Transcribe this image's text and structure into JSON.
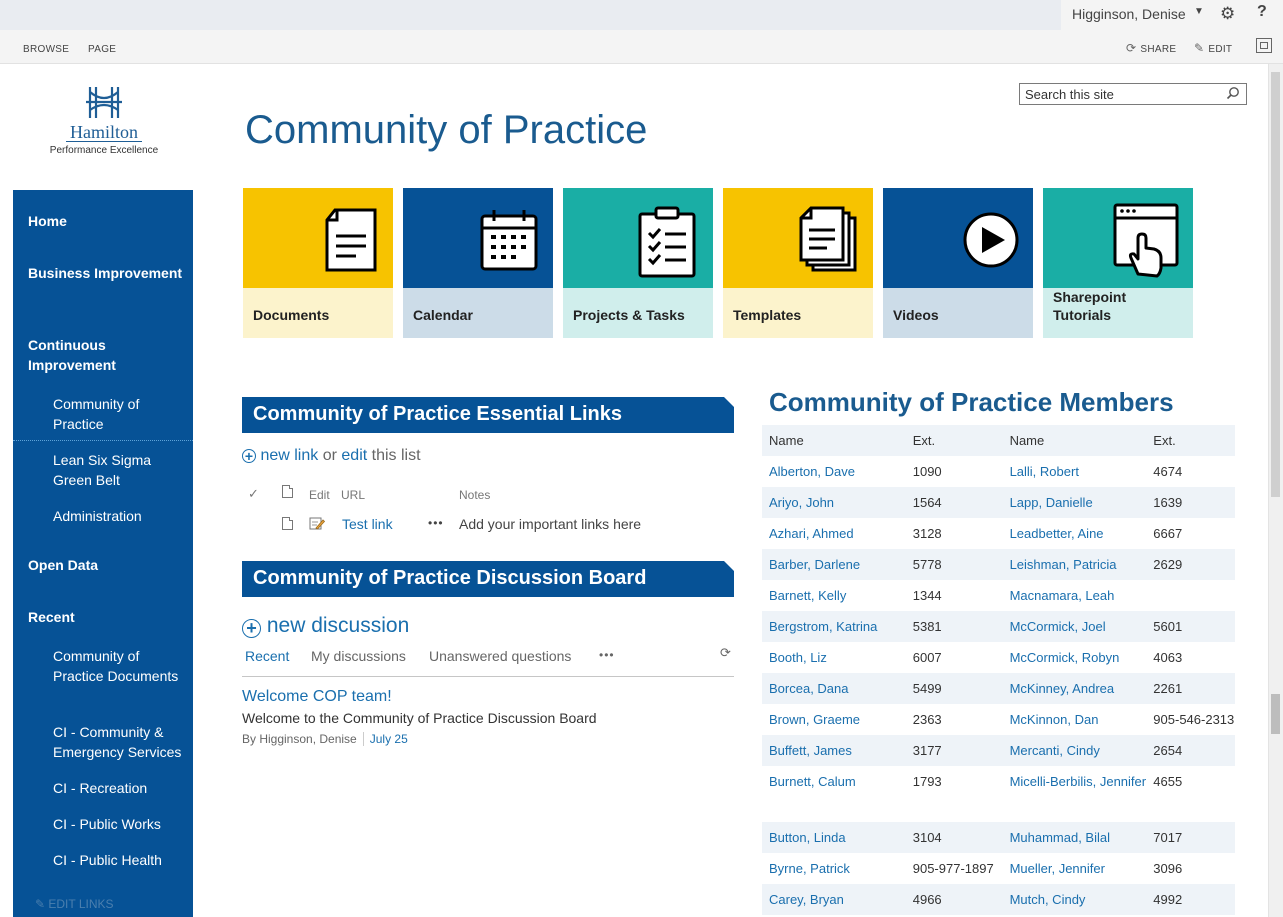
{
  "suite_bar": {
    "username": "Higginson, Denise"
  },
  "ribbon": {
    "tabs": [
      "BROWSE",
      "PAGE"
    ],
    "share_label": "SHARE",
    "edit_label": "EDIT"
  },
  "logo": {
    "name": "Hamilton",
    "tagline": "Performance Excellence"
  },
  "search": {
    "placeholder": "Search this site"
  },
  "page": {
    "title": "Community of Practice"
  },
  "nav": {
    "home": "Home",
    "business_improvement": "Business Improvement",
    "continuous_improvement": "Continuous Improvement",
    "community_of_practice": "Community of Practice",
    "lean_six_sigma": "Lean Six Sigma Green Belt",
    "administration": "Administration",
    "open_data": "Open Data",
    "recent": "Recent",
    "recent_items": [
      "Community of Practice Documents",
      "CI - Community & Emergency Services",
      "CI - Recreation",
      "CI - Public Works",
      "CI - Public Health"
    ],
    "edit_links": "EDIT LINKS"
  },
  "tiles": [
    {
      "label": "Documents",
      "top_color": "#f7c300",
      "bottom_color": "#fcf3cc",
      "icon": "document-icon"
    },
    {
      "label": "Calendar",
      "top_color": "#065296",
      "bottom_color": "#ccdce8",
      "icon": "calendar-icon"
    },
    {
      "label": "Projects & Tasks",
      "top_color": "#1aaea5",
      "bottom_color": "#d0eeec",
      "icon": "clipboard-checklist-icon"
    },
    {
      "label": "Templates",
      "top_color": "#f7c300",
      "bottom_color": "#fcf3cc",
      "icon": "stacked-documents-icon"
    },
    {
      "label": "Videos",
      "top_color": "#065296",
      "bottom_color": "#ccdce8",
      "icon": "play-icon"
    },
    {
      "label": "Sharepoint Tutorials",
      "top_color": "#1aaea5",
      "bottom_color": "#d0eeec",
      "icon": "browser-pointer-icon"
    }
  ],
  "essential_links": {
    "heading": "Community of Practice Essential Links",
    "new_link": "new link",
    "or": "or",
    "edit": "edit",
    "this_list": "this list",
    "columns": {
      "edit": "Edit",
      "url": "URL",
      "notes": "Notes"
    },
    "rows": [
      {
        "url": "Test link",
        "notes": "Add your important links here"
      }
    ]
  },
  "discussion": {
    "heading": "Community of Practice Discussion Board",
    "new_discussion": "new discussion",
    "tabs": [
      "Recent",
      "My discussions",
      "Unanswered questions",
      "•••"
    ],
    "post": {
      "title": "Welcome COP team!",
      "body": "Welcome to the Community of Practice Discussion Board",
      "author": "By Higginson, Denise",
      "date": "July 25"
    }
  },
  "members": {
    "title": "Community of Practice Members",
    "columns": [
      "Name",
      "Ext.",
      "Name",
      "Ext."
    ],
    "rows": [
      [
        "Alberton, Dave",
        "1090",
        "Lalli, Robert",
        "4674"
      ],
      [
        "Ariyo, John",
        "1564",
        "Lapp, Danielle",
        "1639"
      ],
      [
        "Azhari, Ahmed",
        "3128",
        "Leadbetter, Aine",
        "6667"
      ],
      [
        "Barber, Darlene",
        "5778",
        "Leishman, Patricia",
        "2629"
      ],
      [
        "Barnett, Kelly",
        "1344",
        "Macnamara, Leah",
        ""
      ],
      [
        "Bergstrom, Katrina",
        "5381",
        "McCormick, Joel",
        "5601"
      ],
      [
        "Booth, Liz",
        "6007",
        "McCormick, Robyn",
        "4063"
      ],
      [
        "Borcea, Dana",
        "5499",
        "McKinney, Andrea",
        "2261"
      ],
      [
        "Brown, Graeme",
        "2363",
        "McKinnon, Dan",
        "905-546-2313"
      ],
      [
        "Buffett, James",
        "3177",
        "Mercanti, Cindy",
        "2654"
      ],
      [
        "Burnett, Calum",
        "1793",
        "Micelli-Berbilis, Jennifer",
        "4655"
      ],
      [
        "Button, Linda",
        "3104",
        "Muhammad, Bilal",
        "7017"
      ],
      [
        "Byrne, Patrick",
        "905-977-1897",
        "Mueller, Jennifer",
        "3096"
      ],
      [
        "Carey, Bryan",
        "4966",
        "Mutch, Cindy",
        "4992"
      ]
    ]
  }
}
